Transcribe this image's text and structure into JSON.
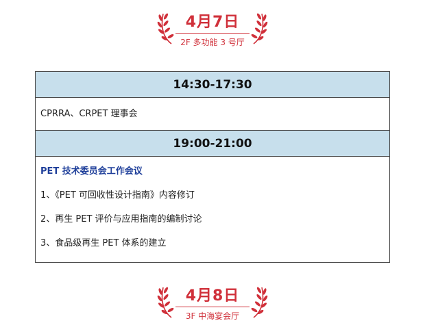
{
  "days": [
    {
      "date": "4月7日",
      "venue": "2F 多功能 3 号厅"
    },
    {
      "date": "4月8日",
      "venue": "3F 中海宴会厅"
    }
  ],
  "sessions": [
    {
      "time": "14:30-17:30",
      "heading": "",
      "items": [
        "CPRRA、CRPET 理事会"
      ]
    },
    {
      "time": "19:00-21:00",
      "heading": "PET 技术委员会工作会议",
      "items": [
        "1、《PET 可回收性设计指南》内容修订",
        "2、再生 PET 评价与应用指南的编制讨论",
        "3、食品级再生 PET 体系的建立"
      ]
    }
  ],
  "colors": {
    "accent": "#d0303a",
    "time_row_bg": "#c7dfec",
    "heading": "#1f3f9a",
    "border": "#4a4a4a"
  },
  "icons": {
    "decoration": "laurel-wreath-icon"
  }
}
